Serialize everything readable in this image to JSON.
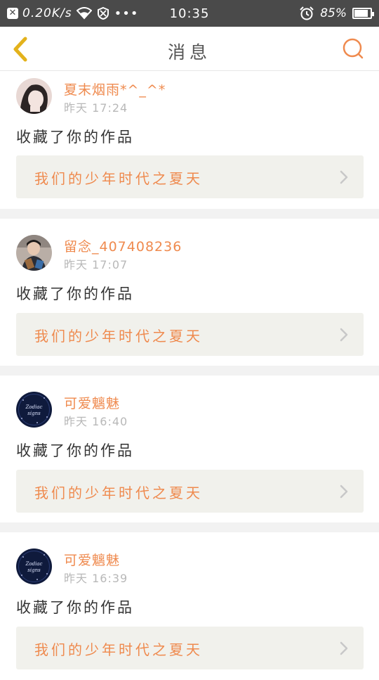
{
  "status_bar": {
    "speed": "0.20K/s",
    "time": "10:35",
    "battery": "85%",
    "battery_level": 0.85
  },
  "header": {
    "title": "消息",
    "back_icon": "chevron-left-icon",
    "search_icon": "search-icon"
  },
  "colors": {
    "accent": "#ef8a4e",
    "back_yellow": "#e3b21c",
    "card_bg": "#f1f1ec"
  },
  "messages": [
    {
      "user": "夏末烟雨*^_^*",
      "time": "昨天 17:24",
      "action": "收藏了你的作品",
      "work": "我们的少年时代之夏天"
    },
    {
      "user": "留念_407408236",
      "time": "昨天 17:07",
      "action": "收藏了你的作品",
      "work": "我们的少年时代之夏天"
    },
    {
      "user": "可爱魑魅",
      "time": "昨天 16:40",
      "action": "收藏了你的作品",
      "work": "我们的少年时代之夏天",
      "avatar_text": [
        "Zodiac",
        "signs"
      ]
    },
    {
      "user": "可爱魑魅",
      "time": "昨天 16:39",
      "action": "收藏了你的作品",
      "work": "我们的少年时代之夏天",
      "avatar_text": [
        "Zodiac",
        "signs"
      ]
    }
  ]
}
